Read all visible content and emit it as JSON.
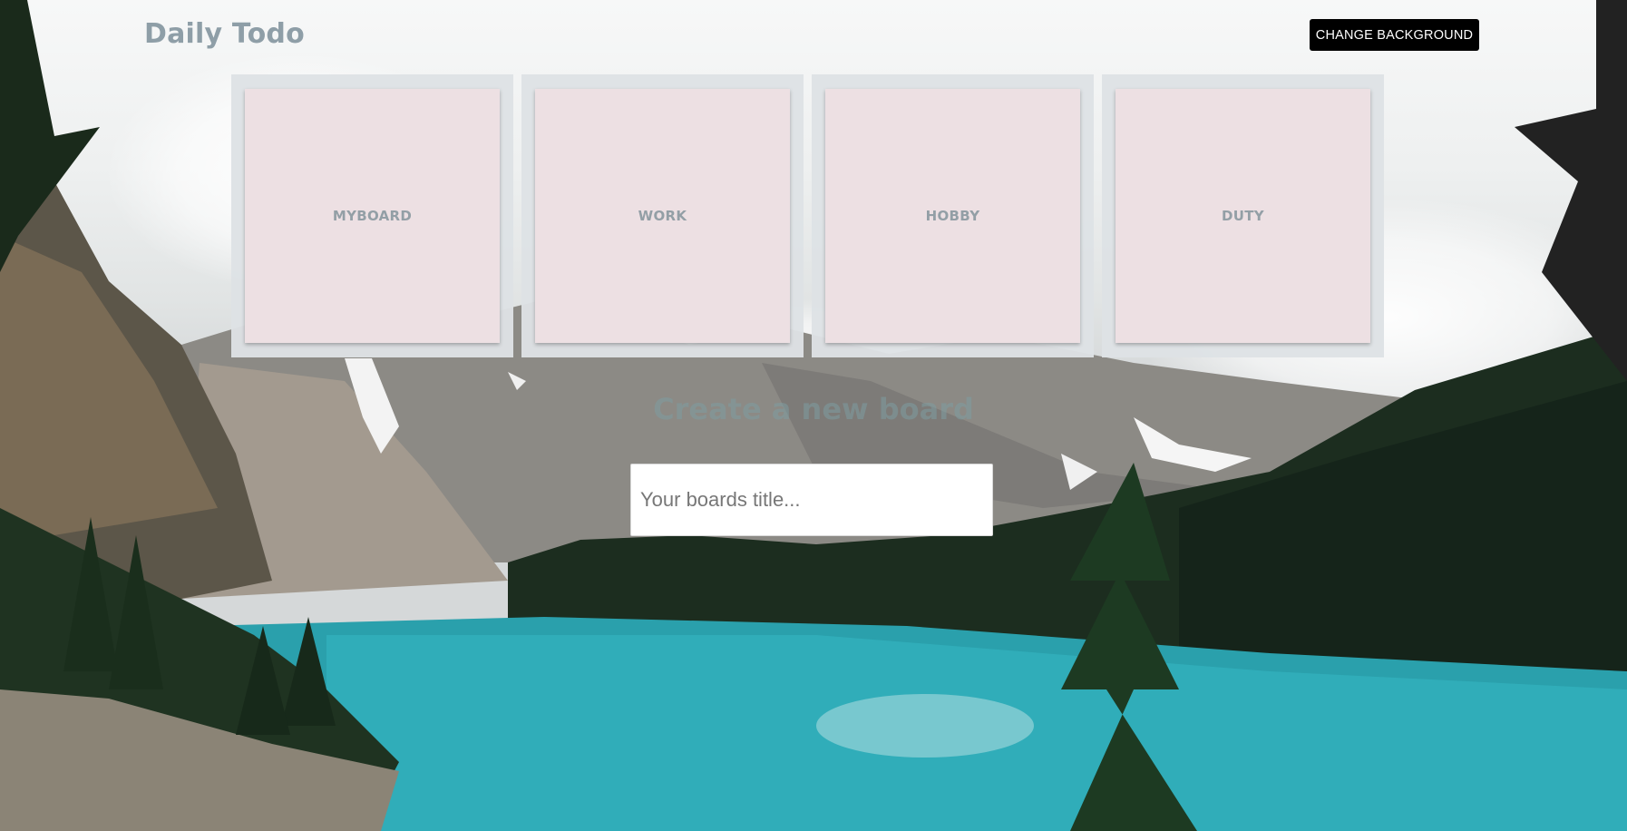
{
  "header": {
    "app_title": "Daily Todo",
    "change_background_label": "CHANGE BACKGROUND"
  },
  "boards": [
    {
      "label": "MYBOARD"
    },
    {
      "label": "WORK"
    },
    {
      "label": "HOBBY"
    },
    {
      "label": "DUTY"
    }
  ],
  "create_board": {
    "heading": "Create a new board",
    "input_placeholder": "Your boards title...",
    "input_value": ""
  },
  "background": {
    "scene": "mountain-lake-photo"
  },
  "colors": {
    "accent_button": "#000000",
    "card": "#ede0e3",
    "title": "#8e9ea7"
  }
}
